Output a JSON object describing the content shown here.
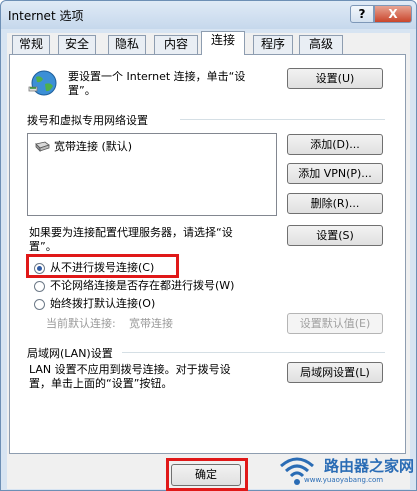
{
  "window": {
    "title": "Internet 选项",
    "help_icon": "?",
    "close_icon": "X"
  },
  "tabs": [
    {
      "label": "常规"
    },
    {
      "label": "安全"
    },
    {
      "label": "隐私"
    },
    {
      "label": "内容"
    },
    {
      "label": "连接",
      "active": true
    },
    {
      "label": "程序"
    },
    {
      "label": "高级"
    }
  ],
  "setup": {
    "text_line1": "要设置一个 Internet 连接，单击“设",
    "text_line2": "置”。",
    "button": "设置(U)"
  },
  "dialup": {
    "section_title": "拨号和虚拟专用网络设置",
    "connections": [
      {
        "label": "宽带连接 (默认)"
      }
    ],
    "add_button": "添加(D)...",
    "add_vpn_button": "添加 VPN(P)...",
    "remove_button": "删除(R)...",
    "proxy_text_line1": "如果要为连接配置代理服务器，请选择“设",
    "proxy_text_line2": "置”。",
    "settings_button": "设置(S)",
    "options": [
      {
        "label": "从不进行拨号连接(C)",
        "selected": true
      },
      {
        "label": "不论网络连接是否存在都进行拨号(W)",
        "selected": false
      },
      {
        "label": "始终拨打默认连接(O)",
        "selected": false
      }
    ],
    "current_default_label": "当前默认连接:",
    "current_default_value": "宽带连接",
    "set_default_button": "设置默认值(E)"
  },
  "lan": {
    "section_title": "局域网(LAN)设置",
    "text_line1": "LAN 设置不应用到拨号连接。对于拨号设",
    "text_line2": "置，单击上面的“设置”按钮。",
    "button": "局域网设置(L)"
  },
  "footer": {
    "ok_button": "确定"
  },
  "watermark": {
    "text": "路由器之家网",
    "url": "www.yuaoyabang.com"
  },
  "colors": {
    "highlight": "#e01818",
    "accent": "#2a6cb5"
  }
}
